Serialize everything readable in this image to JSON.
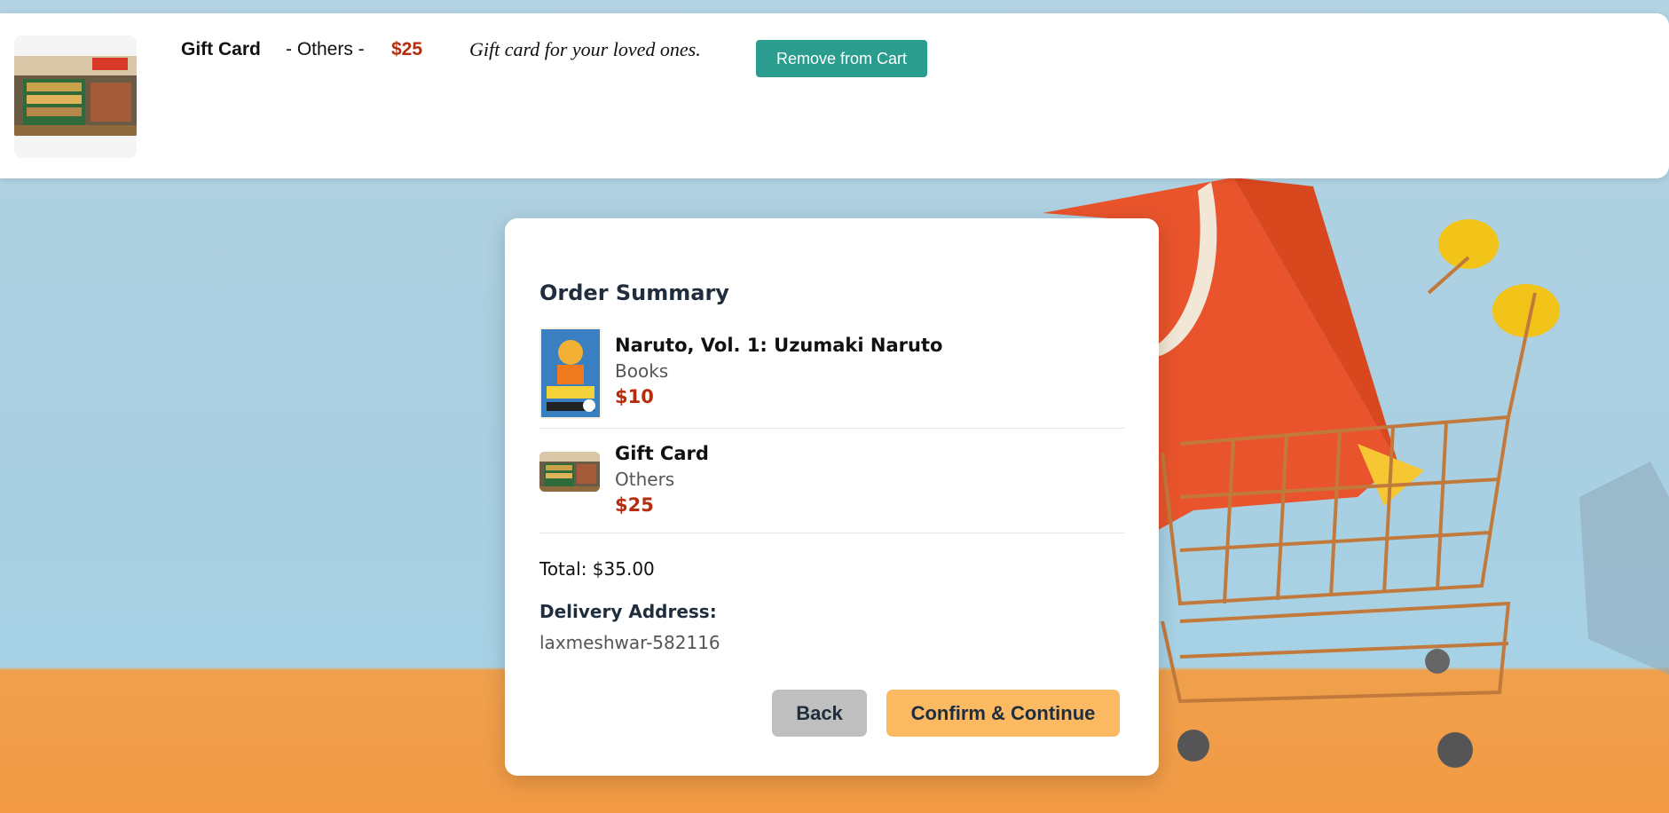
{
  "cart_item": {
    "name": "Gift Card",
    "category": "- Others -",
    "price": "$25",
    "description": "Gift card for your loved ones.",
    "remove_label": "Remove from Cart"
  },
  "summary": {
    "title": "Order Summary",
    "items": [
      {
        "name": "Naruto, Vol. 1: Uzumaki Naruto",
        "category": "Books",
        "price": "$10",
        "image_alt": "Naruto Vol. 1 cover"
      },
      {
        "name": "Gift Card",
        "category": "Others",
        "price": "$25",
        "image_alt": "Grocery store produce aisle"
      }
    ],
    "total": "Total: $35.00",
    "address_label": "Delivery Address:",
    "address_value": "laxmeshwar-582116",
    "back_label": "Back",
    "confirm_label": "Confirm & Continue"
  },
  "colors": {
    "accent_teal": "#2a9d8f",
    "price_red": "#b32d0e",
    "confirm_orange": "#fbb962",
    "back_gray": "#bfbfbf"
  }
}
